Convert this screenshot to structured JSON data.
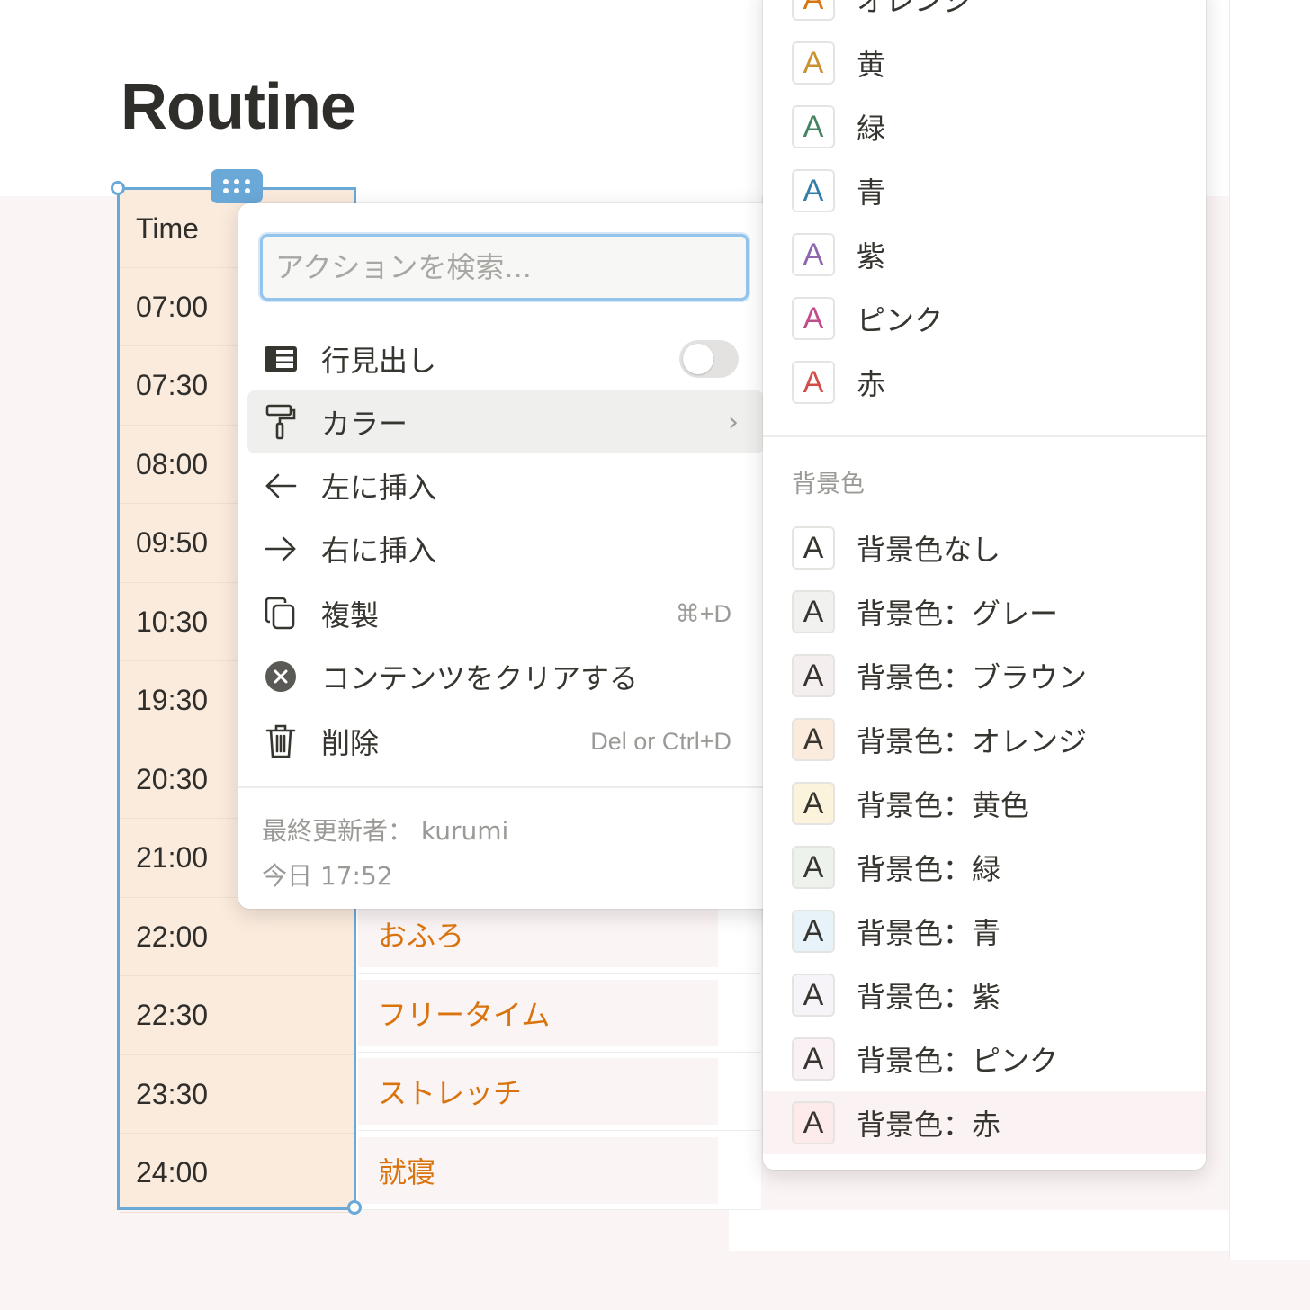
{
  "page": {
    "title": "Routine"
  },
  "table": {
    "header": "Time",
    "times": [
      "07:00",
      "07:30",
      "08:00",
      "09:50",
      "10:30",
      "19:30",
      "20:30",
      "21:00",
      "22:00",
      "22:30",
      "23:30",
      "24:00"
    ],
    "tasks_visible": [
      {
        "row": 8,
        "text": "おふろ"
      },
      {
        "row": 9,
        "text": "フリータイム"
      },
      {
        "row": 10,
        "text": "ストレッチ"
      },
      {
        "row": 11,
        "text": "就寝"
      }
    ]
  },
  "menu": {
    "search_placeholder": "アクションを検索...",
    "items": [
      {
        "label": "行見出し",
        "icon": "row-header-icon",
        "toggle": false
      },
      {
        "label": "カラー",
        "icon": "paint-roller-icon",
        "active": true
      },
      {
        "label": "左に挿入",
        "icon": "arrow-left-icon"
      },
      {
        "label": "右に挿入",
        "icon": "arrow-right-icon"
      },
      {
        "label": "複製",
        "icon": "duplicate-icon",
        "shortcut": "⌘+D"
      },
      {
        "label": "コンテンツをクリアする",
        "icon": "clear-icon"
      },
      {
        "label": "削除",
        "icon": "trash-icon",
        "shortcut": "Del or Ctrl+D"
      }
    ],
    "last_edited_by": "最終更新者： kurumi",
    "last_edited_time": "今日 17:52"
  },
  "colors": {
    "text_colors": [
      {
        "label": "オレンジ",
        "color": "#d9730d"
      },
      {
        "label": "黄",
        "color": "#cb912f"
      },
      {
        "label": "緑",
        "color": "#448361"
      },
      {
        "label": "青",
        "color": "#337ea9"
      },
      {
        "label": "紫",
        "color": "#9065b0"
      },
      {
        "label": "ピンク",
        "color": "#c14c8a"
      },
      {
        "label": "赤",
        "color": "#d44c47"
      }
    ],
    "background_section": "背景色",
    "background_colors": [
      {
        "label": "背景色なし",
        "bg": "#ffffff"
      },
      {
        "label": "背景色：グレー",
        "bg": "#f1f1ef"
      },
      {
        "label": "背景色：ブラウン",
        "bg": "#f4eeee"
      },
      {
        "label": "背景色：オレンジ",
        "bg": "#faebdd"
      },
      {
        "label": "背景色：黄色",
        "bg": "#fbf3db"
      },
      {
        "label": "背景色：緑",
        "bg": "#edf3ec"
      },
      {
        "label": "背景色：青",
        "bg": "#e7f3f8"
      },
      {
        "label": "背景色：紫",
        "bg": "#f6f3f9"
      },
      {
        "label": "背景色：ピンク",
        "bg": "#faf1f5"
      },
      {
        "label": "背景色：赤",
        "bg": "#fdebec"
      }
    ],
    "swatch_letter": "A"
  }
}
